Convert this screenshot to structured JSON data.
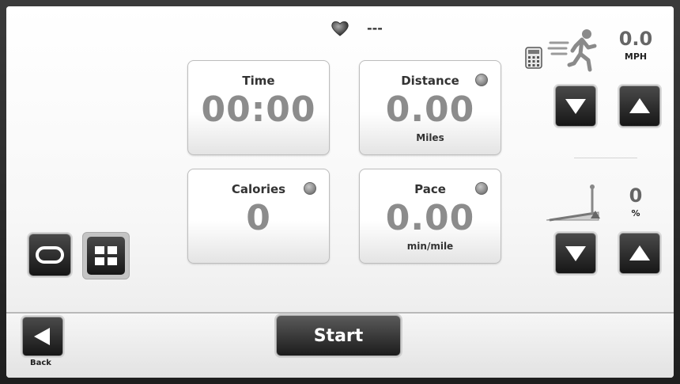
{
  "heart_rate": {
    "icon": "heart-icon",
    "value": "---"
  },
  "tiles": {
    "time": {
      "label": "Time",
      "value": "00:00"
    },
    "distance": {
      "label": "Distance",
      "value": "0.00",
      "unit": "Miles"
    },
    "calories": {
      "label": "Calories",
      "value": "0"
    },
    "pace": {
      "label": "Pace",
      "value": "0.00",
      "unit": "min/mile"
    }
  },
  "speed": {
    "value": "0.0",
    "unit": "MPH",
    "icons": [
      "calculator-icon",
      "runner-icon"
    ]
  },
  "incline": {
    "value": "0",
    "unit": "%",
    "icon": "incline-ramp-icon"
  },
  "controls": {
    "speed_down": "arrow-down-icon",
    "speed_up": "arrow-up-icon",
    "incline_down": "arrow-down-icon",
    "incline_up": "arrow-up-icon"
  },
  "views": [
    "track-view-icon",
    "grid-view-icon"
  ],
  "bottom": {
    "back_label": "Back",
    "start_label": "Start"
  }
}
